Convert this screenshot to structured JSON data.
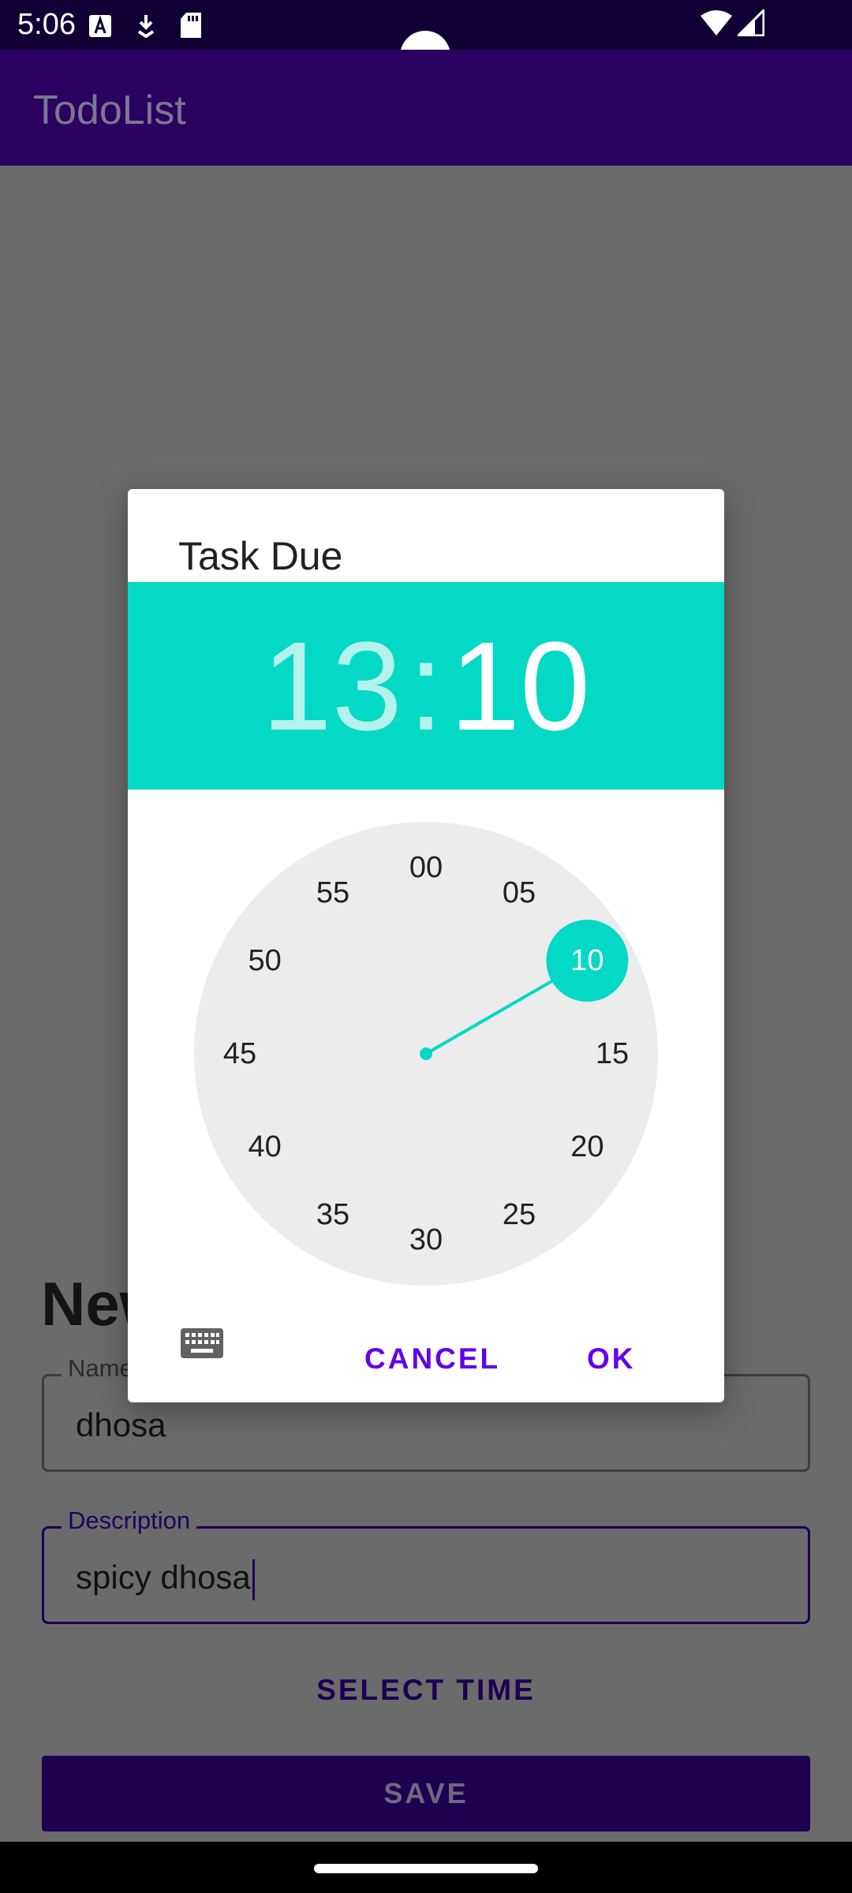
{
  "status_bar": {
    "time": "5:06",
    "icons": [
      "a-icon",
      "download-icon",
      "sd-card-icon",
      "wifi-icon",
      "signal-icon"
    ]
  },
  "app_bar": {
    "title": "TodoList"
  },
  "form": {
    "title": "New",
    "name_label": "Name",
    "name_value": "dhosa",
    "description_label": "Description",
    "description_value": "spicy dhosa",
    "select_time_label": "SELECT TIME",
    "save_label": "SAVE"
  },
  "dialog": {
    "title": "Task Due",
    "hour": "13",
    "separator": ":",
    "minute": "10",
    "selected_minute": 10,
    "clock_labels": [
      "00",
      "05",
      "10",
      "15",
      "20",
      "25",
      "30",
      "35",
      "40",
      "45",
      "50",
      "55"
    ],
    "cancel_label": "CANCEL",
    "ok_label": "OK"
  },
  "colors": {
    "accent": "#03d9c4",
    "button_text": "#6200ee",
    "app_bar": "#2a0061",
    "status_bar": "#100034"
  }
}
